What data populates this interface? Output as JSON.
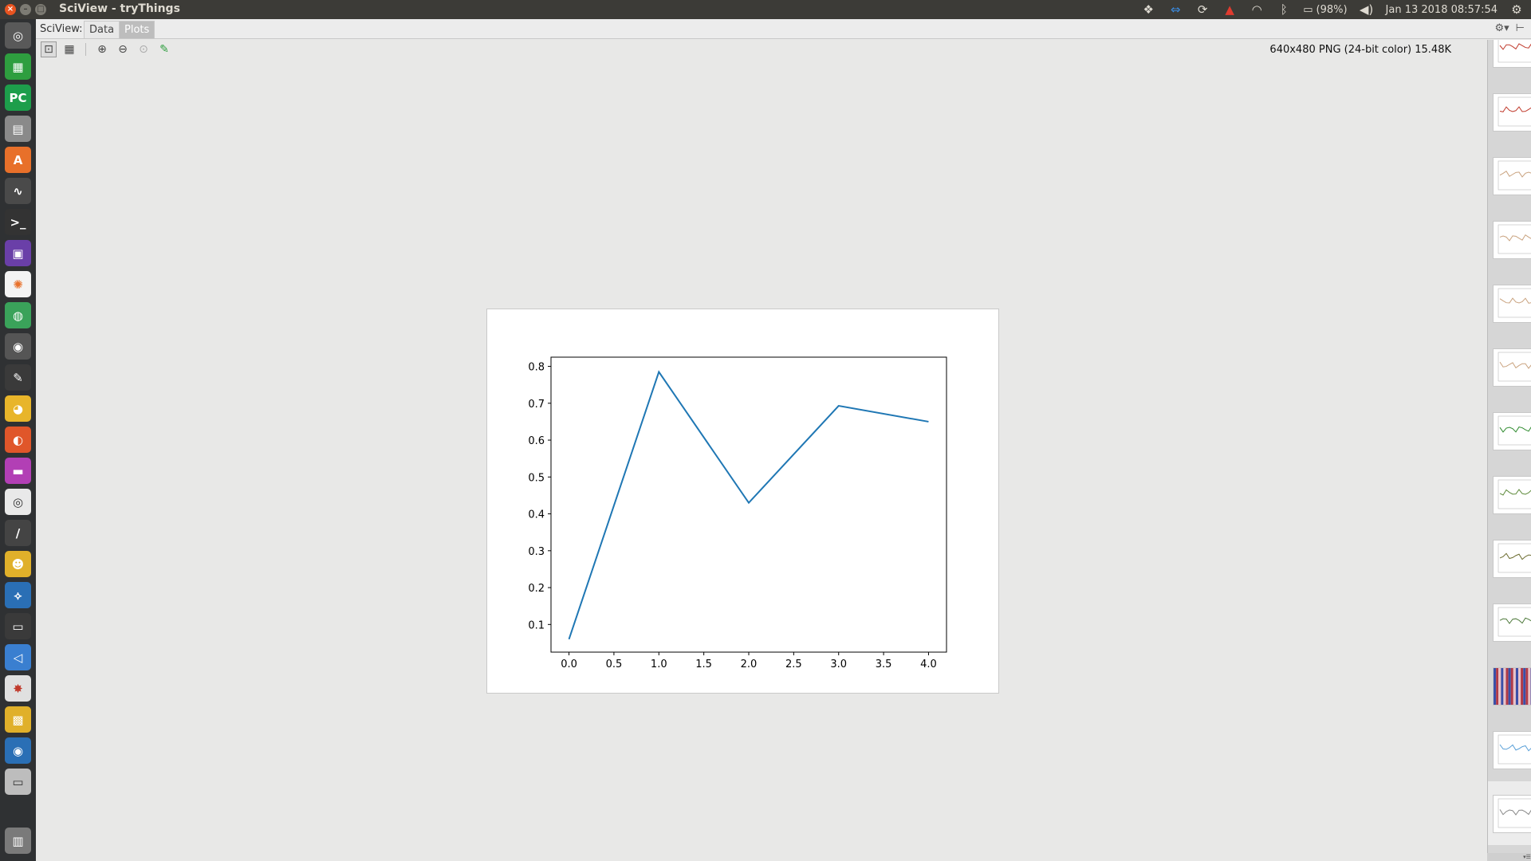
{
  "window": {
    "title": "SciView - tryThings",
    "clock": "Jan 13 2018 08:57:54",
    "battery": "(98%)"
  },
  "app": {
    "prefix": "SciView:",
    "tabs": [
      {
        "label": "Data",
        "active": false
      },
      {
        "label": "Plots",
        "active": true
      }
    ],
    "image_info": "640x480 PNG (24-bit color) 15.48K"
  },
  "thumbnails": [
    {
      "kind": "line",
      "color": "#c0392b"
    },
    {
      "kind": "line",
      "color": "#c0392b"
    },
    {
      "kind": "line",
      "color": "#c9a27e"
    },
    {
      "kind": "line",
      "color": "#c9a27e"
    },
    {
      "kind": "line",
      "color": "#c9a27e"
    },
    {
      "kind": "line",
      "color": "#c9a27e"
    },
    {
      "kind": "line",
      "color": "#2e8b2e"
    },
    {
      "kind": "line",
      "color": "#5d8a3a"
    },
    {
      "kind": "line",
      "color": "#6b6b2e"
    },
    {
      "kind": "line",
      "color": "#4f7a3c"
    },
    {
      "kind": "heatmap",
      "color": "#b03a48"
    },
    {
      "kind": "line",
      "color": "#5aa0d8"
    },
    {
      "kind": "line",
      "color": "#888888",
      "selected": true
    }
  ],
  "chart_data": {
    "type": "line",
    "x": [
      0,
      1,
      2,
      3,
      4
    ],
    "series": [
      {
        "values": [
          0.06,
          0.785,
          0.43,
          0.693,
          0.65
        ],
        "color": "#1f77b4"
      }
    ],
    "xlim": [
      -0.2,
      4.2
    ],
    "ylim": [
      0.025,
      0.825
    ],
    "xticks": [
      0.0,
      0.5,
      1.0,
      1.5,
      2.0,
      2.5,
      3.0,
      3.5,
      4.0
    ],
    "xtick_labels": [
      "0.0",
      "0.5",
      "1.0",
      "1.5",
      "2.0",
      "2.5",
      "3.0",
      "3.5",
      "4.0"
    ],
    "yticks": [
      0.1,
      0.2,
      0.3,
      0.4,
      0.5,
      0.6,
      0.7,
      0.8
    ],
    "ytick_labels": [
      "0.1",
      "0.2",
      "0.3",
      "0.4",
      "0.5",
      "0.6",
      "0.7",
      "0.8"
    ],
    "grid": false
  }
}
